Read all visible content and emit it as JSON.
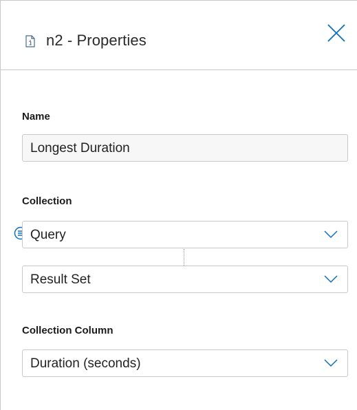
{
  "header": {
    "title": "n2 - Properties",
    "icons": {
      "document": "document-info-icon",
      "close": "close-icon"
    }
  },
  "name_field": {
    "label": "Name",
    "value": "Longest Duration"
  },
  "collection": {
    "label": "Collection",
    "source_value": "Query",
    "source_icon": "query-list-icon",
    "subset_value": "Result Set"
  },
  "collection_column": {
    "label": "Collection Column",
    "value": "Duration (seconds)"
  },
  "colors": {
    "accent": "#0a6fc2",
    "border": "#c9c9c9",
    "text": "#1a1a1a"
  }
}
